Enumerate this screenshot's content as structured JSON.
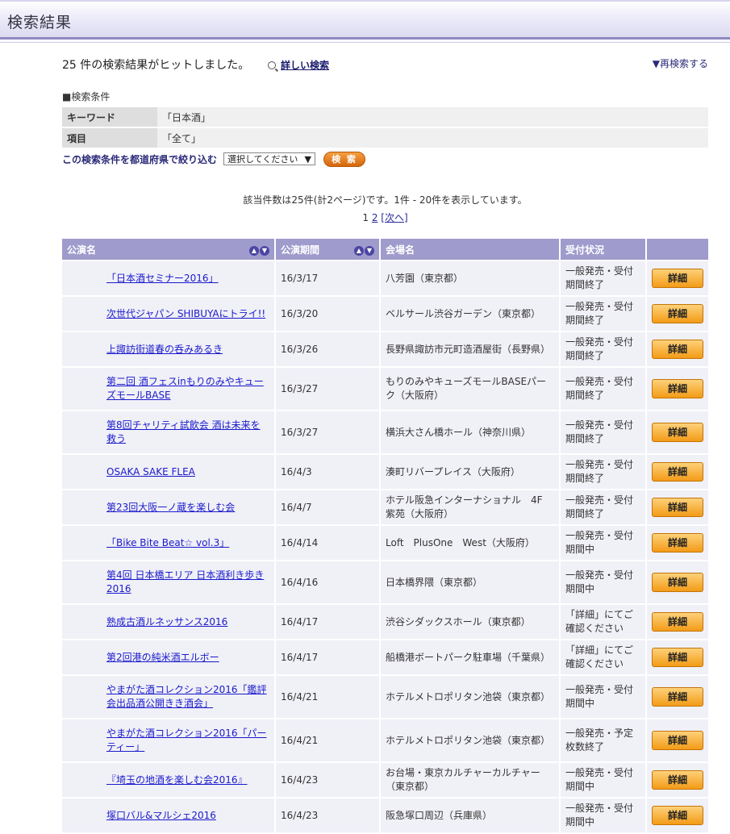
{
  "header": {
    "title": "検索結果"
  },
  "top": {
    "hit_text": "25 件の検索結果がヒットしました。",
    "detail_search": "詳しい検索",
    "research": "再検索する"
  },
  "conditions": {
    "title": "■検索条件",
    "rows": [
      {
        "key": "キーワード",
        "value": "「日本酒」"
      },
      {
        "key": "項目",
        "value": "「全て」"
      }
    ],
    "narrow_label": "この検索条件を都道府県で絞り込む",
    "select_value": "選択してください",
    "search_button": "検 索"
  },
  "summary": "該当件数は25件(計2ページ)です。1件 - 20件を表示しています。",
  "pager": {
    "current": "1",
    "page2": "2",
    "next": "[次へ]"
  },
  "table": {
    "headers": [
      "公演名",
      "公演期間",
      "会場名",
      "受付状況",
      ""
    ],
    "detail_label": "詳細",
    "rows": [
      {
        "name": "「日本酒セミナー2016」",
        "date": "16/3/17",
        "venue": "八芳園（東京都）",
        "status": "一般発売・受付期間終了"
      },
      {
        "name": "次世代ジャパン SHIBUYAにトライ!!",
        "date": "16/3/20",
        "venue": "ベルサール渋谷ガーデン（東京都）",
        "status": "一般発売・受付期間終了"
      },
      {
        "name": "上諏訪街道春の呑みあるき",
        "date": "16/3/26",
        "venue": "長野県諏訪市元町造酒屋街（長野県）",
        "status": "一般発売・受付期間終了"
      },
      {
        "name": "第二回 酒フェスinもりのみやキューズモールBASE",
        "date": "16/3/27",
        "venue": "もりのみやキューズモールBASEパーク（大阪府）",
        "status": "一般発売・受付期間終了"
      },
      {
        "name": "第8回チャリティ試飲会 酒は未来を救う",
        "date": "16/3/27",
        "venue": "横浜大さん橋ホール（神奈川県）",
        "status": "一般発売・受付期間終了"
      },
      {
        "name": "OSAKA SAKE FLEA",
        "date": "16/4/3",
        "venue": "湊町リバープレイス（大阪府）",
        "status": "一般発売・受付期間終了"
      },
      {
        "name": "第23回大阪一ノ蔵を楽しむ会",
        "date": "16/4/7",
        "venue": "ホテル阪急インターナショナル　4F 紫苑（大阪府）",
        "status": "一般発売・受付期間終了"
      },
      {
        "name": "「Bike Bite Beat☆ vol.3」",
        "date": "16/4/14",
        "venue": "Loft　PlusOne　West（大阪府）",
        "status": "一般発売・受付期間中"
      },
      {
        "name": "第4回 日本橋エリア 日本酒利き歩き2016",
        "date": "16/4/16",
        "venue": "日本橋界隈（東京都）",
        "status": "一般発売・受付期間中"
      },
      {
        "name": "熟成古酒ルネッサンス2016",
        "date": "16/4/17",
        "venue": "渋谷シダックスホール（東京都）",
        "status": "「詳細」にてご確認ください"
      },
      {
        "name": "第2回港の純米酒エルボー",
        "date": "16/4/17",
        "venue": "船橋港ボートパーク駐車場（千葉県）",
        "status": "「詳細」にてご確認ください"
      },
      {
        "name": "やまがた酒コレクション2016「鑑評会出品酒公開きき酒会」",
        "date": "16/4/21",
        "venue": "ホテルメトロポリタン池袋（東京都）",
        "status": "一般発売・受付期間中"
      },
      {
        "name": "やまがた酒コレクション2016「パーティー」",
        "date": "16/4/21",
        "venue": "ホテルメトロポリタン池袋（東京都）",
        "status": "一般発売・予定枚数終了"
      },
      {
        "name": "『埼玉の地酒を楽しむ会2016』",
        "date": "16/4/23",
        "venue": "お台場・東京カルチャーカルチャー（東京都）",
        "status": "一般発売・受付期間中"
      },
      {
        "name": "塚口バル&マルシェ2016",
        "date": "16/4/23",
        "venue": "阪急塚口周辺（兵庫県）",
        "status": "一般発売・受付期間中"
      }
    ]
  }
}
